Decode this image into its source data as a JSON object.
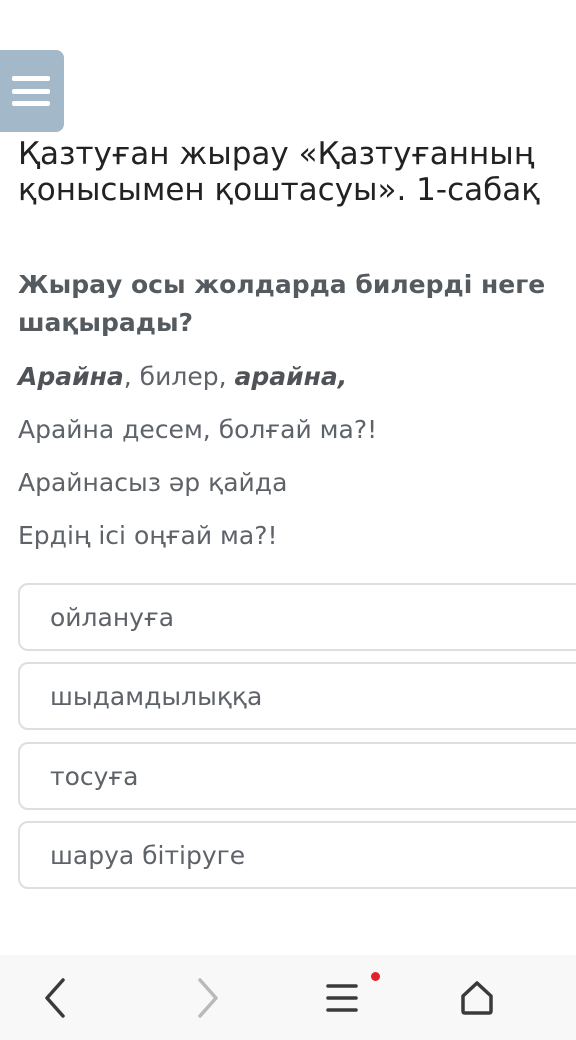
{
  "header": {
    "menu_icon": "hamburger-menu-icon",
    "title_line1": "Қазтуған жырау «Қазтуғанның",
    "title_line2": "қонысымен қоштасуы». 1-сабақ"
  },
  "question": {
    "prompt": "Жырау осы жолдарда билерді неге шақырады?",
    "poem": {
      "line1_part1": "Арайна",
      "line1_part2": ", билер, ",
      "line1_part3": "арайна,",
      "line2": "Арайна десем, болғай ма?!",
      "line3": "Арайнасыз әр қайда",
      "line4": "Ердің ісі оңғай ма?!"
    }
  },
  "options": [
    {
      "label": "ойлануға"
    },
    {
      "label": "шыдамдылыққа"
    },
    {
      "label": "тосуға"
    },
    {
      "label": "шаруа бітіруге"
    }
  ],
  "browser_nav": {
    "back_icon": "chevron-left-icon",
    "forward_icon": "chevron-right-icon",
    "menu_icon": "menu-lines-icon",
    "home_icon": "home-icon",
    "notification_color": "#e4202c"
  }
}
